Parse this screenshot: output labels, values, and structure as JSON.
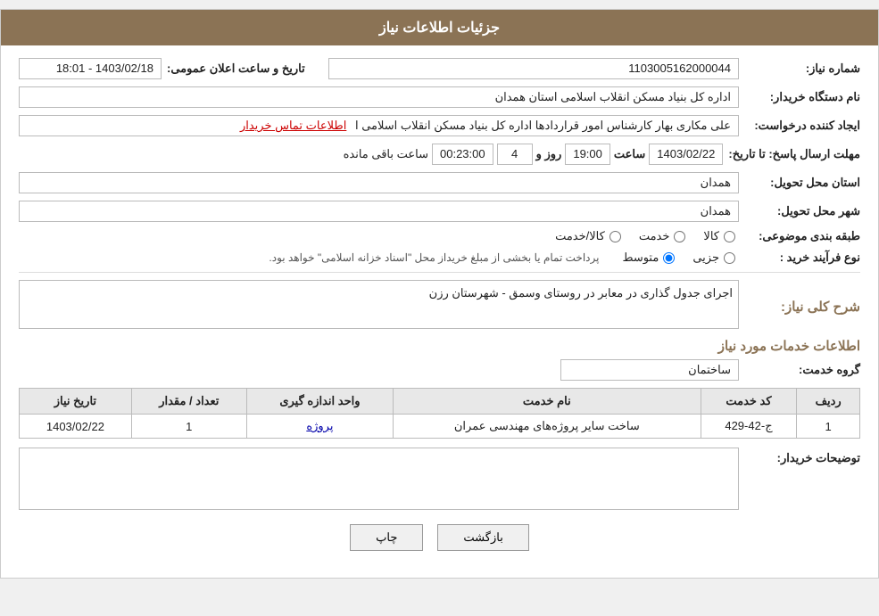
{
  "page": {
    "title": "جزئیات اطلاعات نیاز"
  },
  "fields": {
    "need_number_label": "شماره نیاز:",
    "need_number_value": "1103005162000044",
    "announce_label": "تاریخ و ساعت اعلان عمومی:",
    "announce_value": "1403/02/18 - 18:01",
    "requester_label": "نام دستگاه خریدار:",
    "requester_value": "اداره کل بنیاد مسکن انقلاب اسلامی استان همدان",
    "creator_label": "ایجاد کننده درخواست:",
    "creator_value": "علی مکاری بهار کارشناس امور قراردادها اداره کل بنیاد مسکن انقلاب اسلامی ا",
    "creator_link": "اطلاعات تماس خریدار",
    "deadline_label": "مهلت ارسال پاسخ: تا تاریخ:",
    "deadline_date": "1403/02/22",
    "deadline_time_label": "ساعت",
    "deadline_time": "19:00",
    "deadline_days_label": "روز و",
    "deadline_days": "4",
    "deadline_remaining": "00:23:00",
    "deadline_remaining_label": "ساعت باقی مانده",
    "province_label": "استان محل تحویل:",
    "province_value": "همدان",
    "city_label": "شهر محل تحویل:",
    "city_value": "همدان",
    "category_label": "طبقه بندی موضوعی:",
    "radio_kala": "کالا",
    "radio_khedmat": "خدمت",
    "radio_kala_khedmat": "کالا/خدمت",
    "process_label": "نوع فرآیند خرید :",
    "radio_jozvi": "جزیی",
    "radio_motovaset": "متوسط",
    "process_note": "پرداخت تمام یا بخشی از مبلغ خریداز محل \"اسناد خزانه اسلامی\" خواهد بود.",
    "description_label": "شرح کلی نیاز:",
    "description_value": "اجرای جدول گذاری در معابر در روستای وسمق - شهرستان رزن",
    "service_info_title": "اطلاعات خدمات مورد نیاز",
    "service_group_label": "گروه خدمت:",
    "service_group_value": "ساختمان",
    "table": {
      "headers": [
        "ردیف",
        "کد خدمت",
        "نام خدمت",
        "واحد اندازه گیری",
        "تعداد / مقدار",
        "تاریخ نیاز"
      ],
      "rows": [
        {
          "row": "1",
          "code": "ج-42-429",
          "name": "ساخت سایر پروژه‌های مهندسی عمران",
          "unit": "پروژه",
          "quantity": "1",
          "date": "1403/02/22"
        }
      ]
    },
    "buyer_notes_label": "توضیحات خریدار:",
    "buyer_notes_value": "",
    "btn_back": "بازگشت",
    "btn_print": "چاپ"
  }
}
